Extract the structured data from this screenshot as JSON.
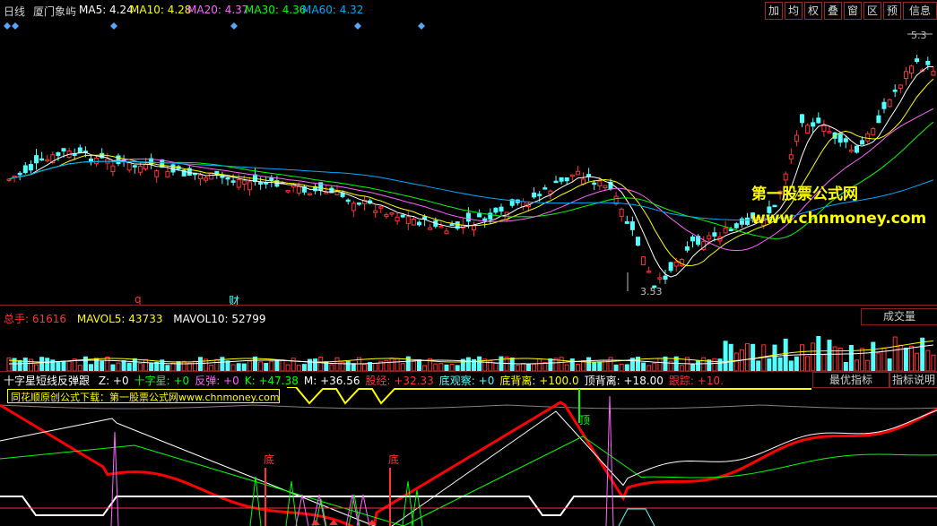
{
  "header": {
    "period": "日线",
    "stock_name": "厦门象屿",
    "ma": [
      {
        "label": "MA5: 4.24",
        "color": "#ffffff"
      },
      {
        "label": "MA10: 4.28",
        "color": "#ffff00"
      },
      {
        "label": "MA20: 4.37",
        "color": "#ff66ff"
      },
      {
        "label": "MA30: 4.36",
        "color": "#00ff00"
      },
      {
        "label": "MA60: 4.32",
        "color": "#00aaff"
      }
    ],
    "toolbar": [
      "加",
      "均",
      "权",
      "叠",
      "窗",
      "区",
      "预",
      "信息"
    ]
  },
  "main_chart": {
    "high_label": "5.3",
    "low_label": "3.53",
    "marker_q": "q",
    "marker_cai": "财",
    "watermark_title": "第一股票公式网",
    "watermark_url": "www.chnmoney.com",
    "colors": {
      "up": "#ff3333",
      "down": "#54ffff"
    }
  },
  "volume_panel": {
    "total": "总手: 61616",
    "mavol5": "MAVOL5: 43733",
    "mavol10": "MAVOL10: 52799",
    "tab": "成交量"
  },
  "indicator_panel": {
    "name": "十字星短线反弹跟",
    "items": [
      {
        "label": "Z: +0",
        "color": "#ffffff"
      },
      {
        "label": "十字星: +0",
        "color": "#00ff00"
      },
      {
        "label": "反弹: +0",
        "color": "#ff66ff"
      },
      {
        "label": "K: +47.38",
        "color": "#00ff00"
      },
      {
        "label": "M: +36.56",
        "color": "#ffffff"
      },
      {
        "label": "股经: +32.33",
        "color": "#ff3333"
      },
      {
        "label": "底观察: +0",
        "color": "#54ffff"
      },
      {
        "label": "底背离: +100.0",
        "color": "#ffff00"
      },
      {
        "label": "顶背离: +18.00",
        "color": "#ffffff"
      },
      {
        "label": "跟踪: +10.",
        "color": "#ff3333"
      }
    ],
    "tab_best": "最优指标",
    "tab_explain": "指标说明",
    "notice": "同花顺原创公式下载：第一股票公式网www.chnmoney.com",
    "di_label": "底",
    "ding_label": "顶"
  }
}
